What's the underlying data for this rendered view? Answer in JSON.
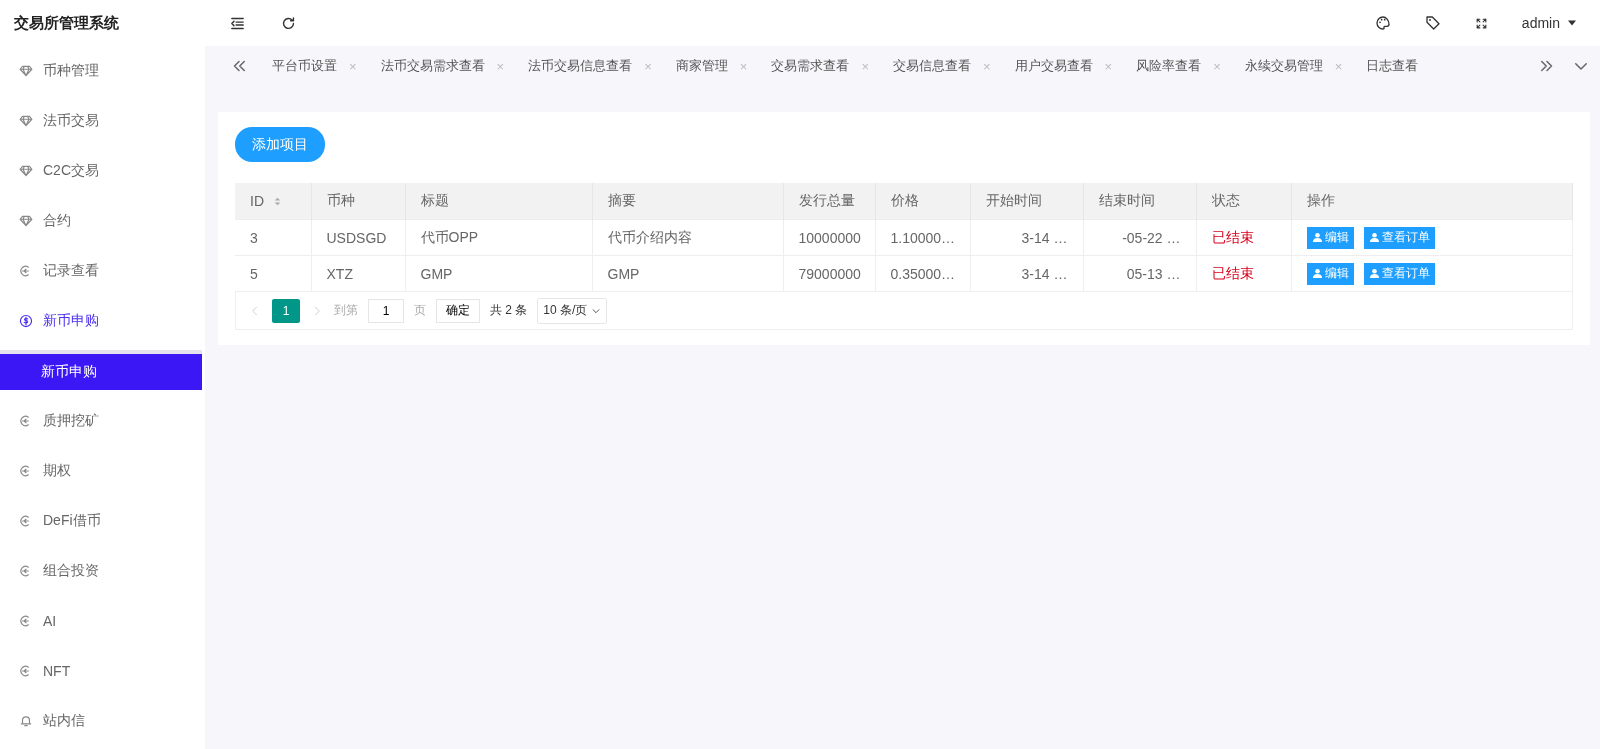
{
  "app_title": "交易所管理系统",
  "header": {
    "user": "admin"
  },
  "sidebar": {
    "items": [
      {
        "label": "币种管理",
        "kind": "diamond",
        "expanded": false
      },
      {
        "label": "法币交易",
        "kind": "diamond",
        "expanded": false
      },
      {
        "label": "C2C交易",
        "kind": "diamond",
        "expanded": false
      },
      {
        "label": "合约",
        "kind": "diamond",
        "expanded": false
      },
      {
        "label": "记录查看",
        "kind": "exit",
        "expanded": false
      },
      {
        "label": "新币申购",
        "kind": "dollar",
        "expanded": true,
        "children": [
          {
            "label": "新币申购",
            "selected": true
          }
        ]
      },
      {
        "label": "质押挖矿",
        "kind": "exit",
        "expanded": false
      },
      {
        "label": "期权",
        "kind": "exit",
        "expanded": false
      },
      {
        "label": "DeFi借币",
        "kind": "exit",
        "expanded": false
      },
      {
        "label": "组合投资",
        "kind": "exit",
        "expanded": false
      },
      {
        "label": "AI",
        "kind": "exit",
        "expanded": false
      },
      {
        "label": "NFT",
        "kind": "exit",
        "expanded": false
      },
      {
        "label": "站内信",
        "kind": "bell",
        "expanded": false
      }
    ]
  },
  "tabs": [
    {
      "label": "平台币设置",
      "close": "×",
      "selected": false
    },
    {
      "label": "法币交易需求查看",
      "close": "×",
      "selected": false
    },
    {
      "label": "法币交易信息查看",
      "close": "×",
      "selected": false
    },
    {
      "label": "商家管理",
      "close": "×",
      "selected": false
    },
    {
      "label": "交易需求查看",
      "close": "×",
      "selected": false
    },
    {
      "label": "交易信息查看",
      "close": "×",
      "selected": false
    },
    {
      "label": "用户交易查看",
      "close": "×",
      "selected": false
    },
    {
      "label": "风险率查看",
      "close": "×",
      "selected": false
    },
    {
      "label": "永续交易管理",
      "close": "×",
      "selected": false
    },
    {
      "label": "日志查看",
      "selected": false
    }
  ],
  "add_button": "添加项目",
  "table": {
    "columns": [
      {
        "label": "ID",
        "sortable": true
      },
      {
        "label": "币种",
        "sortable": false
      },
      {
        "label": "标题",
        "sortable": false
      },
      {
        "label": "摘要",
        "sortable": false
      },
      {
        "label": "发行总量",
        "sortable": false
      },
      {
        "label": "价格",
        "sortable": false
      },
      {
        "label": "开始时间",
        "sortable": false
      },
      {
        "label": "结束时间",
        "sortable": false
      },
      {
        "label": "状态",
        "sortable": false
      },
      {
        "label": "操作",
        "sortable": false
      }
    ],
    "rows": [
      {
        "cells": [
          "3",
          "USDSGD",
          "代币OPP",
          "代币介绍内容",
          "10000000",
          "1.10000…",
          "3-14 …",
          "-05-22 …"
        ],
        "status": "已结束",
        "actions": [
          "编辑",
          "查看订单"
        ]
      },
      {
        "cells": [
          "5",
          "XTZ",
          "GMP",
          "GMP",
          "79000000",
          "0.35000…",
          "3-14 …",
          "05-13 …"
        ],
        "status": "已结束",
        "actions": [
          "编辑",
          "查看订单"
        ]
      }
    ]
  },
  "pagination": {
    "pages": [
      {
        "label": "1",
        "selected": true
      }
    ],
    "goto_label": "到第",
    "goto_value": "1",
    "page_unit": "页",
    "confirm": "确定",
    "total": "共 2 条",
    "page_size": "10 条/页"
  }
}
